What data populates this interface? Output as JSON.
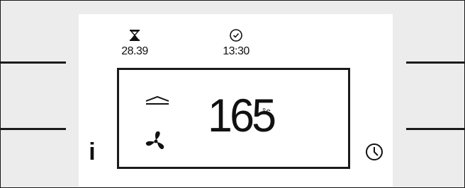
{
  "display": {
    "status_bar": {
      "duration": {
        "icon": "hourglass-icon",
        "value": "28.39"
      },
      "end_time": {
        "icon": "clock-icon",
        "value": "13:30"
      }
    },
    "heating_element": {
      "icon": "top-heat-icon"
    },
    "mode": {
      "icon": "fan-icon"
    },
    "temperature": {
      "value": "165",
      "unit": "°c"
    }
  },
  "controls": {
    "info_button": {
      "label": "i",
      "icon": "info-icon"
    },
    "timer_button": {
      "icon": "clock-icon"
    }
  },
  "colors": {
    "panel": "#ececec",
    "screen": "#ffffff",
    "ink": "#1a1a1a"
  }
}
